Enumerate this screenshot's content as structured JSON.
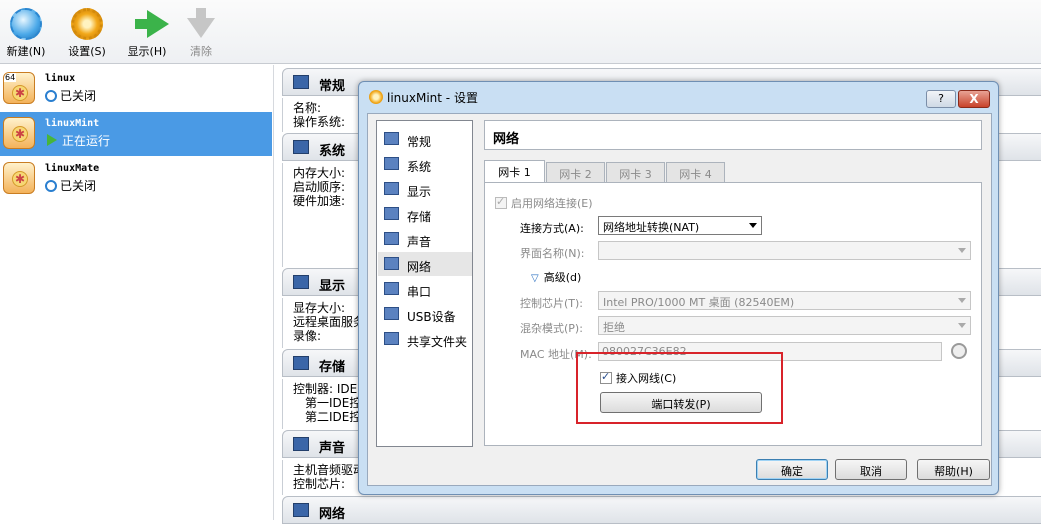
{
  "toolbar": {
    "new_label": "新建(N)",
    "settings_label": "设置(S)",
    "show_label": "显示(H)",
    "discard_label": "清除"
  },
  "vms": [
    {
      "name": "linux",
      "state": "已关闭",
      "badge": "64"
    },
    {
      "name": "linuxMint",
      "state": "正在运行"
    },
    {
      "name": "linuxMate",
      "state": "已关闭"
    }
  ],
  "details": {
    "general": {
      "title": "常规",
      "lines": [
        "名称:",
        "操作系统:"
      ]
    },
    "system": {
      "title": "系统",
      "lines": [
        "内存大小:",
        "启动顺序:",
        "硬件加速:"
      ]
    },
    "display": {
      "title": "显示",
      "lines": [
        "显存大小:",
        "远程桌面服务",
        "录像:"
      ]
    },
    "storage": {
      "title": "存储",
      "lines": [
        "控制器: IDE",
        "第一IDE控",
        "第二IDE控"
      ]
    },
    "audio": {
      "title": "声音",
      "lines": [
        "主机音频驱动",
        "控制芯片:"
      ]
    },
    "network": {
      "title": "网络"
    }
  },
  "dialog": {
    "title": "linuxMint - 设置",
    "help_btn": "?",
    "close_btn": "X",
    "categories": [
      "常规",
      "系统",
      "显示",
      "存储",
      "声音",
      "网络",
      "串口",
      "USB设备",
      "共享文件夹"
    ],
    "selected_category": "网络",
    "panel_title": "网络",
    "tabs": [
      "网卡 1",
      "网卡 2",
      "网卡 3",
      "网卡 4"
    ],
    "enable_adapter": "启用网络连接(E)",
    "attached_label": "连接方式(A):",
    "attached_value": "网络地址转换(NAT)",
    "name_label": "界面名称(N):",
    "name_value": "",
    "advanced_label": "高级(d)",
    "adapter_type_label": "控制芯片(T):",
    "adapter_type_value": "Intel PRO/1000 MT 桌面 (82540EM)",
    "promisc_label": "混杂模式(P):",
    "promisc_value": "拒绝",
    "mac_label": "MAC 地址(M):",
    "mac_value": "080027C36E82",
    "cable_label": "接入网线(C)",
    "port_forward_btn": "端口转发(P)",
    "ok_btn": "确定",
    "cancel_btn": "取消",
    "help_label": "帮助(H)"
  }
}
